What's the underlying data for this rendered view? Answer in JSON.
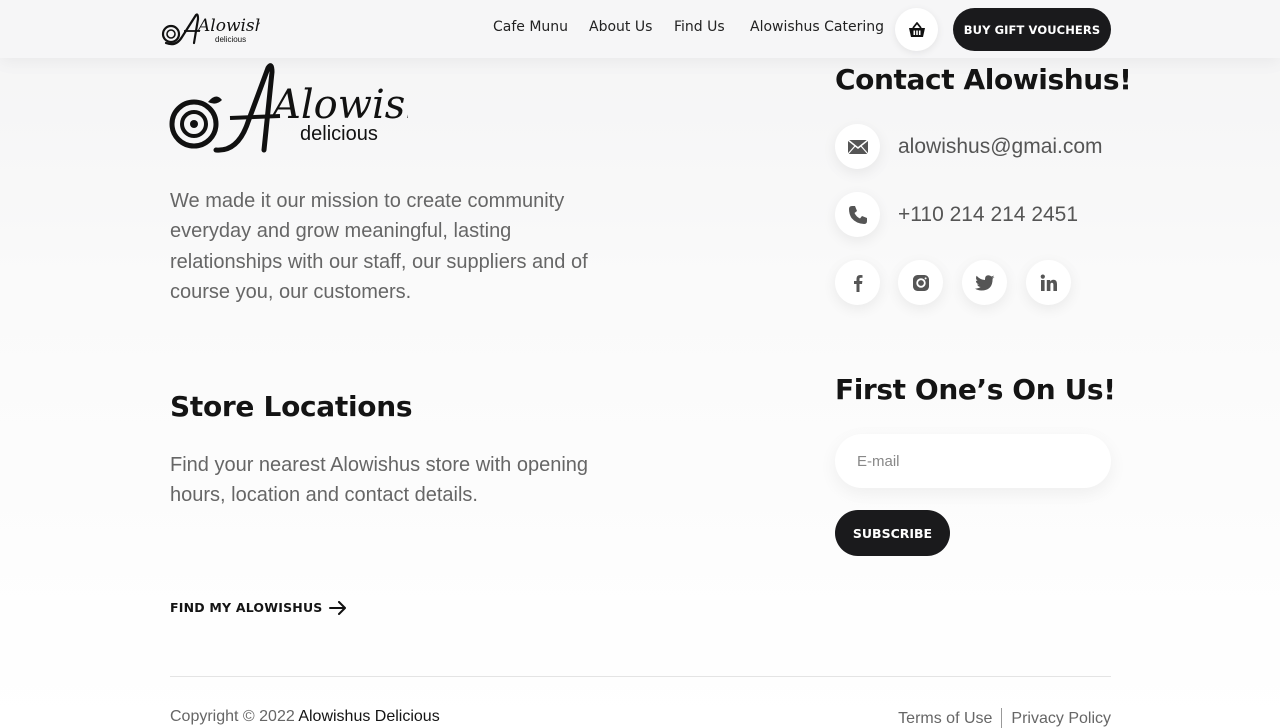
{
  "header": {
    "logo_text": "Alowishus",
    "logo_subtext": "delicious",
    "nav": [
      "Cafe Munu",
      "About Us",
      "Find Us",
      "Alowishus Catering"
    ],
    "cart_icon": "basket-icon",
    "gift_button": "BUY GIFT VOUCHERS"
  },
  "about": {
    "logo_text": "Alowishus",
    "logo_subtext": "delicious",
    "mission": "We made it our mission to create community everyday and grow meaningful, lasting relationships with our staff, our suppliers and of course you, our customers."
  },
  "stores": {
    "title": "Store Locations",
    "text": "Find your nearest Alowishus store with opening hours, location and contact details.",
    "link": "FIND MY ALOWISHUS"
  },
  "contact": {
    "title": "Contact Alowishus!",
    "email": "alowishus@gmai.com",
    "phone": "+110 214 214 2451",
    "socials": [
      "facebook-icon",
      "instagram-icon",
      "twitter-icon",
      "linkedin-icon"
    ]
  },
  "newsletter": {
    "title": "First One’s On Us!",
    "placeholder": "E-mail",
    "button": "SUBSCRIBE"
  },
  "footer": {
    "copyright_prefix": "Copyright © 2022",
    "brand": "Alowishus Delicious",
    "terms": "Terms of Use",
    "privacy": "Privacy Policy"
  },
  "colors": {
    "primary_dark": "#1a1a1c",
    "text_muted": "#666666"
  }
}
